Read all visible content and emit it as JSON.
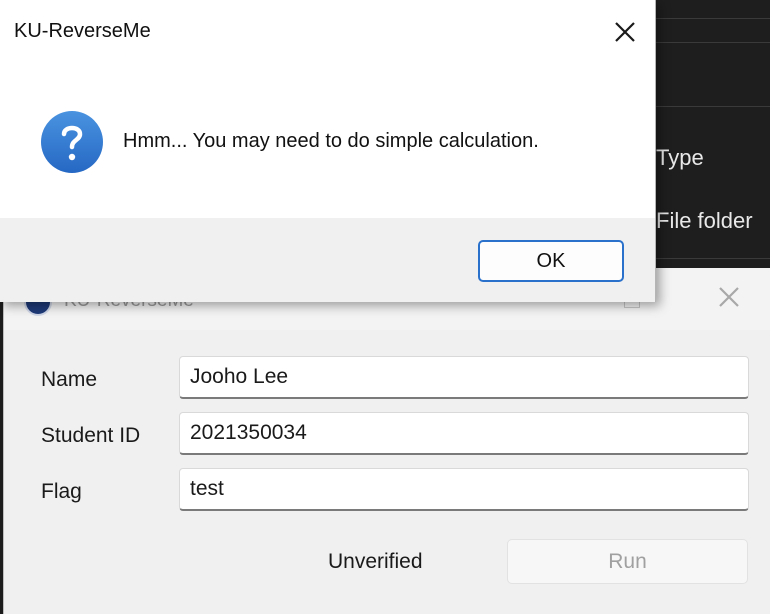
{
  "explorer": {
    "type_header": "Type",
    "row_type": "File folder"
  },
  "app_window": {
    "title": "KU-ReverseMe",
    "fields": [
      {
        "label": "Name",
        "value": "Jooho Lee"
      },
      {
        "label": "Student ID",
        "value": "2021350034"
      },
      {
        "label": "Flag",
        "value": "test"
      }
    ],
    "status": "Unverified",
    "run_label": "Run"
  },
  "dialog": {
    "title": "KU-ReverseMe",
    "message": "Hmm... You may need to do simple calculation.",
    "ok_label": "OK",
    "icon": "question-icon",
    "accent_color": "#2a71cc",
    "icon_color": "#2f7bd3"
  }
}
